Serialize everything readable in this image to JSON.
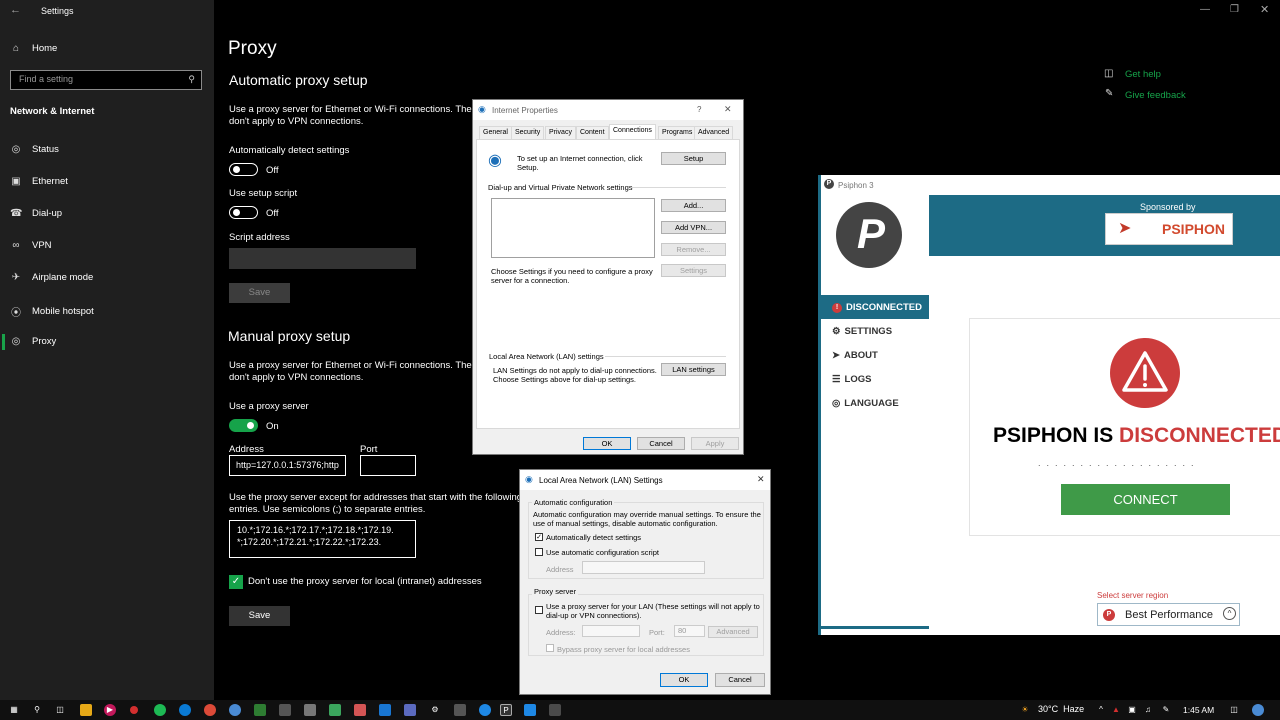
{
  "settings": {
    "window_title": "Settings",
    "home": "Home",
    "search_placeholder": "Find a setting",
    "category": "Network & Internet",
    "nav": [
      "Status",
      "Ethernet",
      "Dial-up",
      "VPN",
      "Airplane mode",
      "Mobile hotspot",
      "Proxy"
    ],
    "page_title": "Proxy",
    "auto": {
      "heading": "Automatic proxy setup",
      "desc_line1": "Use a proxy server for Ethernet or Wi-Fi connections. These",
      "desc_line2": "don't apply to VPN connections.",
      "detect_label": "Automatically detect settings",
      "detect_state": "Off",
      "script_label": "Use setup script",
      "script_state": "Off",
      "address_label": "Script address",
      "save": "Save"
    },
    "manual": {
      "heading": "Manual proxy setup",
      "desc_line1": "Use a proxy server for Ethernet or Wi-Fi connections. These",
      "desc_line2": "don't apply to VPN connections.",
      "use_label": "Use a proxy server",
      "use_state": "On",
      "address_label": "Address",
      "address_value": "http=127.0.0.1:57376;http",
      "port_label": "Port",
      "port_value": "",
      "except_line1": "Use the proxy server except for addresses that start with the following",
      "except_line2": "entries. Use semicolons (;) to separate entries.",
      "except_value_1": "10.*;172.16.*;172.17.*;172.18.*;172.19.",
      "except_value_2": "*;172.20.*;172.21.*;172.22.*;172.23.",
      "local_label": "Don't use the proxy server for local (intranet) addresses",
      "save": "Save"
    },
    "help": {
      "get_help": "Get help",
      "feedback": "Give feedback"
    }
  },
  "inet": {
    "title": "Internet Properties",
    "help_glyph": "?",
    "tabs": [
      "General",
      "Security",
      "Privacy",
      "Content",
      "Connections",
      "Programs",
      "Advanced"
    ],
    "setup_line1": "To set up an Internet connection, click",
    "setup_line2": "Setup.",
    "setup_btn": "Setup",
    "dialup_label": "Dial-up and Virtual Private Network settings",
    "add_btn": "Add...",
    "addvpn_btn": "Add VPN...",
    "remove_btn": "Remove...",
    "settings_btn": "Settings",
    "choose_line1": "Choose Settings if you need to configure a proxy",
    "choose_line2": "server for a connection.",
    "lan_label": "Local Area Network (LAN) settings",
    "lan_line1": "LAN Settings do not apply to dial-up connections.",
    "lan_line2": "Choose Settings above for dial-up settings.",
    "lan_btn": "LAN settings",
    "ok": "OK",
    "cancel": "Cancel",
    "apply": "Apply"
  },
  "lan": {
    "title": "Local Area Network (LAN) Settings",
    "auto_group": "Automatic configuration",
    "auto_line1": "Automatic configuration may override manual settings.  To ensure the",
    "auto_line2": "use of manual settings, disable automatic configuration.",
    "detect": "Automatically detect settings",
    "script": "Use automatic configuration script",
    "address": "Address",
    "proxy_group": "Proxy server",
    "proxy_line1": "Use a proxy server for your LAN (These settings will not apply to",
    "proxy_line2": "dial-up or VPN connections).",
    "addr_label": "Address:",
    "port_label": "Port:",
    "port_value": "80",
    "advanced": "Advanced",
    "bypass": "Bypass proxy server for local addresses",
    "ok": "OK",
    "cancel": "Cancel"
  },
  "psiphon": {
    "title": "Psiphon 3",
    "sponsored": "Sponsored by",
    "banner": "PSIPHON",
    "nav": [
      "DISCONNECTED",
      "SETTINGS",
      "ABOUT",
      "LOGS",
      "LANGUAGE"
    ],
    "status_prefix": "PSIPHON IS ",
    "status_word": "DISCONNECTED",
    "connect": "CONNECT",
    "region_label": "Select server region",
    "region_value": "Best Performance",
    "colors": {
      "teal": "#1d6b85",
      "red": "#cc3c3c",
      "green": "#3f9a48"
    }
  },
  "taskbar": {
    "temp": "30°C",
    "weather": "Haze",
    "time": "1:45 AM"
  }
}
